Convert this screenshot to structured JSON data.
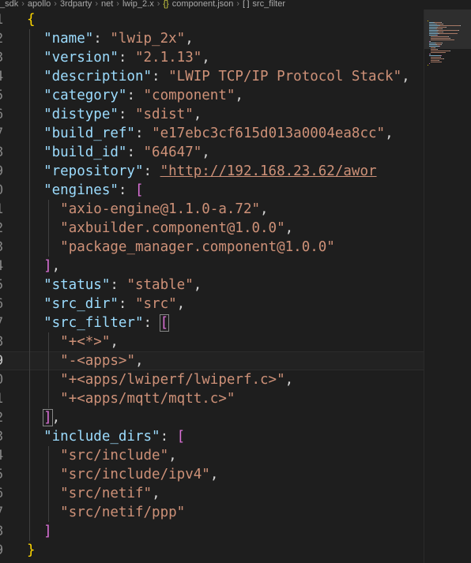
{
  "breadcrumb": {
    "items": [
      "_sdk",
      "apollo",
      "3rdparty",
      "net",
      "lwip_2.x"
    ],
    "file_icon": "{}",
    "file": "component.json",
    "symbol_icon": "[ ]",
    "symbol": "src_filter"
  },
  "editor": {
    "line_numbers": [
      "1",
      "2",
      "3",
      "4",
      "5",
      "6",
      "7",
      "8",
      "9",
      "0",
      "1",
      "2",
      "3",
      "4",
      "5",
      "6",
      "7",
      "8",
      "9",
      "0",
      "1",
      "2",
      "3",
      "4",
      "5",
      "6",
      "7",
      "8",
      "9"
    ],
    "current_line_index": 18,
    "lines": [
      [
        [
          "brace",
          "{"
        ]
      ],
      [
        [
          "txt",
          "  "
        ],
        [
          "key",
          "\"name\""
        ],
        [
          "punc",
          ": "
        ],
        [
          "str",
          "\"lwip_2x\""
        ],
        [
          "punc",
          ","
        ]
      ],
      [
        [
          "txt",
          "  "
        ],
        [
          "key",
          "\"version\""
        ],
        [
          "punc",
          ": "
        ],
        [
          "str",
          "\"2.1.13\""
        ],
        [
          "punc",
          ","
        ]
      ],
      [
        [
          "txt",
          "  "
        ],
        [
          "key",
          "\"description\""
        ],
        [
          "punc",
          ": "
        ],
        [
          "str",
          "\"LWIP TCP/IP Protocol Stack\""
        ],
        [
          "punc",
          ","
        ]
      ],
      [
        [
          "txt",
          "  "
        ],
        [
          "key",
          "\"category\""
        ],
        [
          "punc",
          ": "
        ],
        [
          "str",
          "\"component\""
        ],
        [
          "punc",
          ","
        ]
      ],
      [
        [
          "txt",
          "  "
        ],
        [
          "key",
          "\"distype\""
        ],
        [
          "punc",
          ": "
        ],
        [
          "str",
          "\"sdist\""
        ],
        [
          "punc",
          ","
        ]
      ],
      [
        [
          "txt",
          "  "
        ],
        [
          "key",
          "\"build_ref\""
        ],
        [
          "punc",
          ": "
        ],
        [
          "str",
          "\"e17ebc3cf615d013a0004ea8cc\""
        ],
        [
          "punc",
          ","
        ]
      ],
      [
        [
          "txt",
          "  "
        ],
        [
          "key",
          "\"build_id\""
        ],
        [
          "punc",
          ": "
        ],
        [
          "str",
          "\"64647\""
        ],
        [
          "punc",
          ","
        ]
      ],
      [
        [
          "txt",
          "  "
        ],
        [
          "key",
          "\"repository\""
        ],
        [
          "punc",
          ": "
        ],
        [
          "url",
          "\"http://192.168.23.62/awor"
        ]
      ],
      [
        [
          "txt",
          "  "
        ],
        [
          "key",
          "\"engines\""
        ],
        [
          "punc",
          ": "
        ],
        [
          "bracket",
          "["
        ]
      ],
      [
        [
          "txt",
          "    "
        ],
        [
          "str",
          "\"axio-engine@1.1.0-a.72\""
        ],
        [
          "punc",
          ","
        ]
      ],
      [
        [
          "txt",
          "    "
        ],
        [
          "str",
          "\"axbuilder.component@1.0.0\""
        ],
        [
          "punc",
          ","
        ]
      ],
      [
        [
          "txt",
          "    "
        ],
        [
          "str",
          "\"package_manager.component@1.0.0\""
        ]
      ],
      [
        [
          "txt",
          "  "
        ],
        [
          "bracket",
          "]"
        ],
        [
          "punc",
          ","
        ]
      ],
      [
        [
          "txt",
          "  "
        ],
        [
          "key",
          "\"status\""
        ],
        [
          "punc",
          ": "
        ],
        [
          "str",
          "\"stable\""
        ],
        [
          "punc",
          ","
        ]
      ],
      [
        [
          "txt",
          "  "
        ],
        [
          "key",
          "\"src_dir\""
        ],
        [
          "punc",
          ": "
        ],
        [
          "str",
          "\"src\""
        ],
        [
          "punc",
          ","
        ]
      ],
      [
        [
          "txt",
          "  "
        ],
        [
          "key",
          "\"src_filter\""
        ],
        [
          "punc",
          ": "
        ],
        [
          "bracketm",
          "["
        ]
      ],
      [
        [
          "txt",
          "    "
        ],
        [
          "str",
          "\"+<*>\""
        ],
        [
          "punc",
          ","
        ]
      ],
      [
        [
          "txt",
          "    "
        ],
        [
          "str",
          "\"-<apps>\""
        ],
        [
          "punc",
          ","
        ]
      ],
      [
        [
          "txt",
          "    "
        ],
        [
          "str",
          "\"+<apps/lwiperf/lwiperf.c>\""
        ],
        [
          "punc",
          ","
        ]
      ],
      [
        [
          "txt",
          "    "
        ],
        [
          "str",
          "\"+<apps/mqtt/mqtt.c>\""
        ]
      ],
      [
        [
          "txt",
          "  "
        ],
        [
          "bracketm",
          "]"
        ],
        [
          "punc",
          ","
        ]
      ],
      [
        [
          "txt",
          "  "
        ],
        [
          "key",
          "\"include_dirs\""
        ],
        [
          "punc",
          ": "
        ],
        [
          "bracket",
          "["
        ]
      ],
      [
        [
          "txt",
          "    "
        ],
        [
          "str",
          "\"src/include\""
        ],
        [
          "punc",
          ","
        ]
      ],
      [
        [
          "txt",
          "    "
        ],
        [
          "str",
          "\"src/include/ipv4\""
        ],
        [
          "punc",
          ","
        ]
      ],
      [
        [
          "txt",
          "    "
        ],
        [
          "str",
          "\"src/netif\""
        ],
        [
          "punc",
          ","
        ]
      ],
      [
        [
          "txt",
          "    "
        ],
        [
          "str",
          "\"src/netif/ppp\""
        ]
      ],
      [
        [
          "txt",
          "  "
        ],
        [
          "bracket",
          "]"
        ]
      ],
      [
        [
          "brace",
          "}"
        ]
      ]
    ]
  },
  "colors": {
    "background": "#1e1e1e",
    "key": "#9cdcfe",
    "string": "#ce9178",
    "brace": "#ffd700",
    "bracket": "#da70d6"
  }
}
